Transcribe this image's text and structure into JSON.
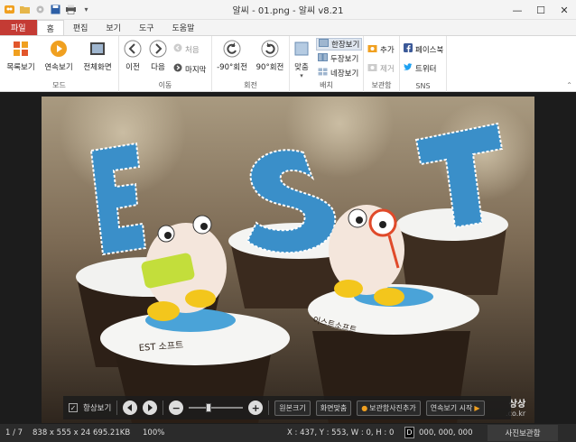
{
  "window": {
    "title": "알씨 - 01.png - 알씨 v8.21",
    "minimize": "—",
    "maximize": "☐",
    "close": "✕"
  },
  "tabs": [
    "파일",
    "홈",
    "편집",
    "보기",
    "도구",
    "도움말"
  ],
  "ribbon": {
    "mode": {
      "label": "모드",
      "thumbnail": "목록보기",
      "slideshow": "연속보기",
      "fullscreen": "전체화면"
    },
    "move": {
      "label": "이동",
      "prev": "이전",
      "next": "다음",
      "first": "처음",
      "last": "마지막"
    },
    "rotate": {
      "label": "회전",
      "ccw": "-90°회전",
      "cw": "90°회전"
    },
    "layout": {
      "label": "배치",
      "fit": "맞춤",
      "single": "한장보기",
      "double": "두장보기",
      "quad": "네장보기"
    },
    "storage": {
      "label": "보관함",
      "add": "추가",
      "remove": "제거"
    },
    "sns": {
      "label": "SNS",
      "facebook": "페이스북",
      "twitter": "트위터"
    }
  },
  "overlay": {
    "always_show": "항상보기",
    "original_size": "원본크기",
    "fit_screen": "화면맞춤",
    "add_to_storage": "보관함사진추가",
    "slideshow_start": "연속보기 시작",
    "checked": true,
    "zoom_level": 0.35
  },
  "watermark": {
    "line1": "상상",
    "line2": ".co.kr"
  },
  "status": {
    "index": "1 / 7",
    "dimensions": "838 x 555 x 24",
    "filesize": "695.21KB",
    "zoom": "100%",
    "coords": "X : 437, Y : 553, W : 0, H : 0",
    "color_label": "D",
    "color_value": "000, 000, 000",
    "album": "사진보관함"
  },
  "colors": {
    "file_tab": "#c43b34",
    "accent_orange": "#f0a020",
    "letters_blue": "#3a8fc9"
  }
}
